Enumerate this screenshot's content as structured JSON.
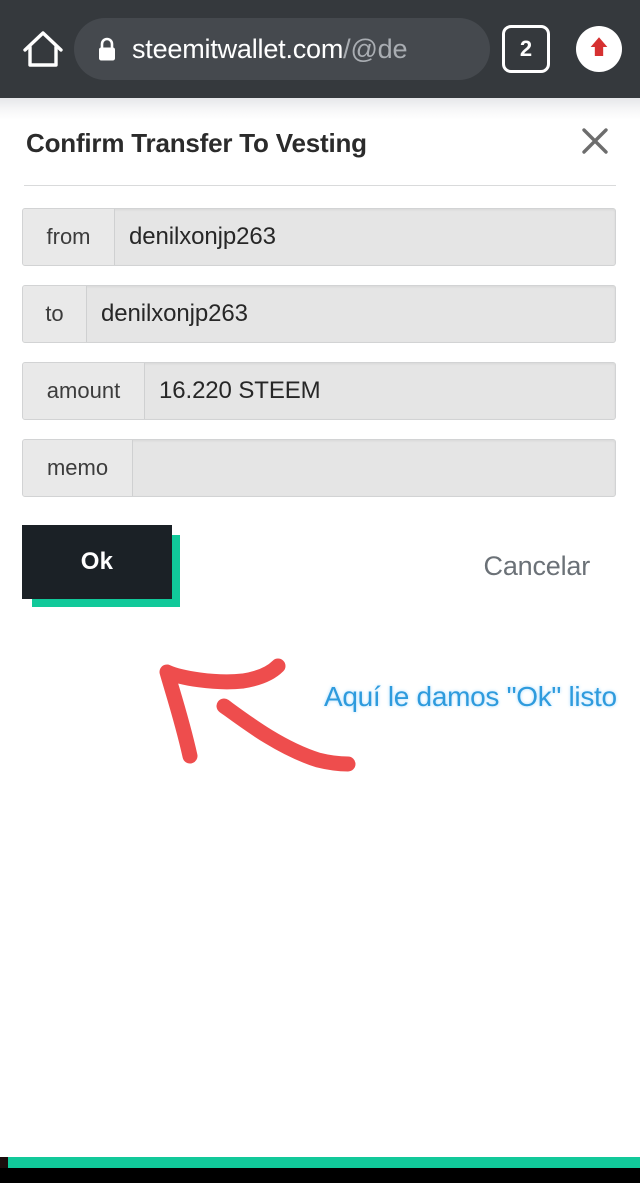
{
  "browser": {
    "home_icon": "home-icon",
    "lock_icon": "lock-icon",
    "url_host": "steemitwallet.com",
    "url_path": "/@de",
    "tab_count": "2",
    "opera_icon": "upload-arrow-icon"
  },
  "dialog": {
    "title": "Confirm Transfer To Vesting",
    "close_icon": "close-icon",
    "fields": [
      {
        "label": "from",
        "value": "denilxonjp263"
      },
      {
        "label": "to",
        "value": "denilxonjp263"
      },
      {
        "label": "amount",
        "value": "16.220 STEEM"
      },
      {
        "label": "memo",
        "value": ""
      }
    ],
    "ok_label": "Ok",
    "cancel_label": "Cancelar"
  },
  "annotation": {
    "text": "Aquí le damos \"Ok\" listo",
    "arrow_icon": "hand-drawn-arrow-icon",
    "arrow_color": "#ee4d4d",
    "text_color": "#2e9bdd"
  },
  "colors": {
    "chrome": "#35393d",
    "accent_teal": "#11c99a",
    "button_dark": "#1b2126",
    "field_bg": "#e5e5e5"
  }
}
